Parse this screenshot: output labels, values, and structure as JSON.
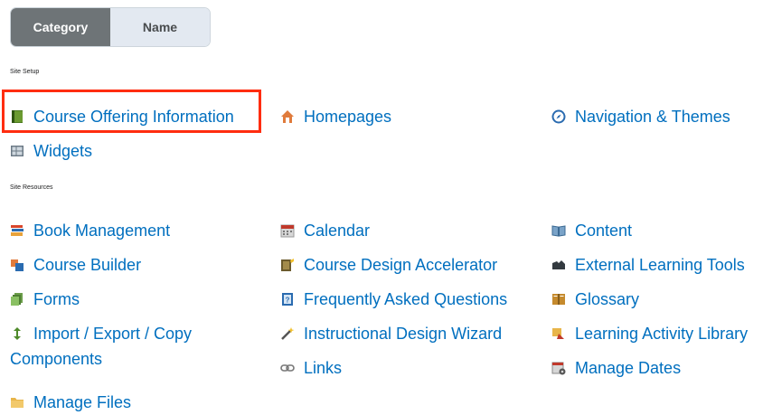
{
  "view_toggle": {
    "category_label": "Category",
    "name_label": "Name",
    "selected": "Category"
  },
  "sections": [
    {
      "title": "Site Setup",
      "tools": [
        {
          "label": "Course Offering Information",
          "icon": "green-book-icon"
        },
        {
          "label": "Homepages",
          "icon": "house-icon"
        },
        {
          "label": "Navigation & Themes",
          "icon": "compass-icon"
        },
        {
          "label": "Widgets",
          "icon": "widget-grid-icon"
        }
      ]
    },
    {
      "title": "Site Resources",
      "tools": [
        {
          "label": "Book Management",
          "icon": "books-icon"
        },
        {
          "label": "Calendar",
          "icon": "calendar-icon"
        },
        {
          "label": "Content",
          "icon": "open-book-icon"
        },
        {
          "label": "Course Builder",
          "icon": "cubes-icon"
        },
        {
          "label": "Course Design Accelerator",
          "icon": "notebook-pencil-icon"
        },
        {
          "label": "External Learning Tools",
          "icon": "puzzle-icon"
        },
        {
          "label": "Forms",
          "icon": "forms-icon"
        },
        {
          "label": "Frequently Asked Questions",
          "icon": "faq-icon"
        },
        {
          "label": "Glossary",
          "icon": "glossary-icon"
        },
        {
          "label": "Import / Export / Copy",
          "label_line2": "Components",
          "icon": "import-export-icon"
        },
        {
          "label": "Instructional Design Wizard",
          "icon": "magic-wand-icon"
        },
        {
          "label": "Learning Activity Library",
          "icon": "library-icon"
        },
        {
          "label": "Links",
          "icon": "link-icon"
        },
        {
          "label": "Manage Dates",
          "icon": "manage-dates-icon"
        },
        {
          "label": "Manage Files",
          "icon": "folder-icon"
        }
      ]
    }
  ],
  "colors": {
    "link": "#006fbf",
    "highlight": "#ff2d10",
    "toggle_active": "#6e7477",
    "toggle_inactive": "#e3e9f1"
  }
}
